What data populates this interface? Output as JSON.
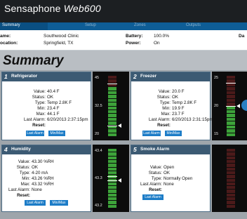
{
  "app": {
    "brand_prefix": "Sensaphone",
    "brand_product": "Web600"
  },
  "nav": {
    "items": [
      {
        "label": "Summary",
        "active": true
      },
      {
        "label": "Setup",
        "active": false
      },
      {
        "label": "Zones",
        "active": false
      },
      {
        "label": "Outputs",
        "active": false
      }
    ]
  },
  "info": {
    "name_label": "ame:",
    "name_value": "Southwood Clinic",
    "location_label": "ocation:",
    "location_value": "Springfield, TX",
    "battery_label": "Battery:",
    "battery_value": "100.0%",
    "power_label": "Power:",
    "power_value": "On",
    "extra_label": "Da"
  },
  "summary": {
    "title": "Summary"
  },
  "zones": [
    {
      "number": "1",
      "title": "Refrigerator",
      "rows": [
        {
          "label": "Value:",
          "value": "40.4 F"
        },
        {
          "label": "Status:",
          "value": "OK"
        },
        {
          "label": "Type:",
          "value": "Temp 2.8K F"
        },
        {
          "label": "Min:",
          "value": "23.4 F"
        },
        {
          "label": "Max:",
          "value": "44.1 F"
        },
        {
          "label": "Last Alarm:",
          "value": "6/20/2013 2:37:15pm"
        }
      ],
      "reset_label": "Reset:",
      "buttons": [
        "Last Alarm",
        "Min/Max"
      ],
      "gauge": {
        "ticks": [
          "45",
          "32.5",
          "20"
        ],
        "level": 0.82,
        "markers": [
          0.13,
          0.82
        ]
      }
    },
    {
      "number": "2",
      "title": "Freezer",
      "rows": [
        {
          "label": "Value:",
          "value": "20.0 F"
        },
        {
          "label": "Status:",
          "value": "OK"
        },
        {
          "label": "Type:",
          "value": "Temp 2.8K F"
        },
        {
          "label": "Min:",
          "value": "19.9 F"
        },
        {
          "label": "Max:",
          "value": "23.7 F"
        },
        {
          "label": "Last Alarm:",
          "value": "6/20/2013 2:31:15pm"
        }
      ],
      "reset_label": "Reset:",
      "buttons": [
        "Last Alarm",
        "Min/Max"
      ],
      "gauge": {
        "ticks": [
          "25",
          "20",
          "15"
        ],
        "level": 0.5,
        "markers": [
          0.12,
          0.5
        ]
      }
    },
    {
      "number": "4",
      "title": "Humidity",
      "rows": [
        {
          "label": "Value:",
          "value": "43.30 %RH"
        },
        {
          "label": "Status:",
          "value": "OK"
        },
        {
          "label": "Type:",
          "value": "4-20 mA"
        },
        {
          "label": "Min:",
          "value": "43.26 %RH"
        },
        {
          "label": "Max:",
          "value": "43.32 %RH"
        },
        {
          "label": "Last Alarm:",
          "value": "None"
        }
      ],
      "reset_label": "Reset:",
      "buttons": [
        "Last Alarm",
        "Min/Max"
      ],
      "gauge": {
        "ticks": [
          "43.4",
          "43.3",
          "43.2"
        ],
        "level": 1.0,
        "markers": [
          0.46,
          0.53
        ]
      }
    },
    {
      "number": "5",
      "title": "Smoke Alarm",
      "rows": [
        {
          "label": "Value:",
          "value": "Open"
        },
        {
          "label": "Status:",
          "value": "OK"
        },
        {
          "label": "Type:",
          "value": "Normally Open"
        },
        {
          "label": "Last Alarm:",
          "value": "None"
        }
      ],
      "reset_label": "Reset:",
      "buttons": [
        "Last Alarm"
      ],
      "gauge": {
        "ticks": [],
        "level": 0.0,
        "markers": []
      }
    }
  ],
  "colors": {
    "nav_bar": "#0e5d96",
    "panel_header": "#3c5a73",
    "gauge_green": "#3da33a",
    "button": "#1c7cc7"
  }
}
